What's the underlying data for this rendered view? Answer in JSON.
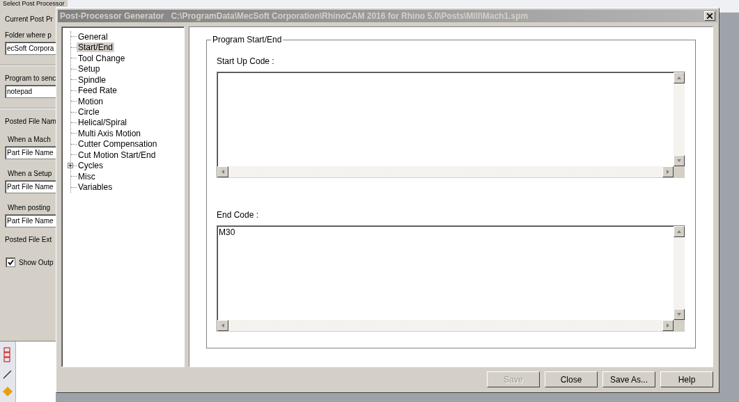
{
  "background_window": {
    "group_title": "Select Post Processor",
    "items": [
      {
        "kind": "label",
        "text": "Current Post Pr"
      },
      {
        "kind": "label",
        "text": "Folder where p"
      },
      {
        "kind": "field",
        "value": "ecSoft Corpora"
      },
      {
        "kind": "divider"
      },
      {
        "kind": "label",
        "text": "Program to senc"
      },
      {
        "kind": "field",
        "value": "notepad"
      },
      {
        "kind": "divider"
      },
      {
        "kind": "label",
        "text": "Posted File Nam"
      },
      {
        "kind": "sublabel",
        "text": "When a Mach"
      },
      {
        "kind": "field",
        "value": "Part File Name"
      },
      {
        "kind": "sublabel",
        "text": "When a Setup"
      },
      {
        "kind": "field",
        "value": "Part File Name"
      },
      {
        "kind": "sublabel",
        "text": "When posting"
      },
      {
        "kind": "field",
        "value": "Part File Name"
      },
      {
        "kind": "label",
        "text": "Posted File Ext"
      },
      {
        "kind": "checkbox",
        "text": "Show Outp",
        "checked": true
      }
    ]
  },
  "dialog": {
    "title": "Post-Processor Generator",
    "path": "C:\\ProgramData\\MecSoft Corporation\\RhinoCAM 2016 for Rhino 5.0\\Posts\\Mill\\Mach1.spm",
    "tree": [
      {
        "label": "General",
        "selected": false,
        "expandable": false
      },
      {
        "label": "Start/End",
        "selected": true,
        "expandable": false
      },
      {
        "label": "Tool Change",
        "selected": false,
        "expandable": false
      },
      {
        "label": "Setup",
        "selected": false,
        "expandable": false
      },
      {
        "label": "Spindle",
        "selected": false,
        "expandable": false
      },
      {
        "label": "Feed Rate",
        "selected": false,
        "expandable": false
      },
      {
        "label": "Motion",
        "selected": false,
        "expandable": false
      },
      {
        "label": "Circle",
        "selected": false,
        "expandable": false
      },
      {
        "label": "Helical/Spiral",
        "selected": false,
        "expandable": false
      },
      {
        "label": "Multi Axis Motion",
        "selected": false,
        "expandable": false
      },
      {
        "label": "Cutter Compensation",
        "selected": false,
        "expandable": false
      },
      {
        "label": "Cut Motion Start/End",
        "selected": false,
        "expandable": false
      },
      {
        "label": "Cycles",
        "selected": false,
        "expandable": true
      },
      {
        "label": "Misc",
        "selected": false,
        "expandable": false
      },
      {
        "label": "Variables",
        "selected": false,
        "expandable": false
      }
    ],
    "group_title": "Program Start/End",
    "code_fields": [
      {
        "label": "Start Up Code :"
      },
      {
        "label": "End Code :",
        "value": "M30"
      }
    ],
    "buttons": [
      {
        "label": "Save",
        "disabled": true
      },
      {
        "label": "Close",
        "disabled": false
      },
      {
        "label": "Save As...",
        "disabled": false
      },
      {
        "label": "Help",
        "disabled": false
      }
    ]
  }
}
